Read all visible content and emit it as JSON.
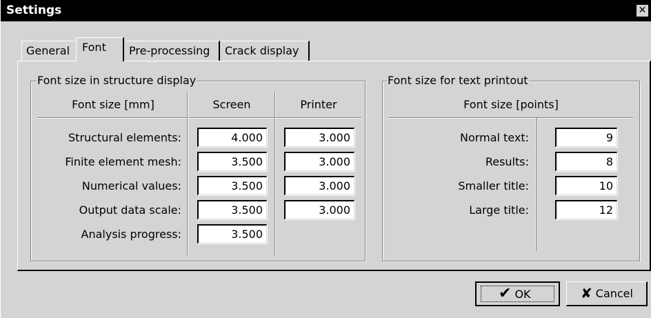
{
  "window": {
    "title": "Settings",
    "close_glyph": "✕"
  },
  "tabs": [
    {
      "label": "General"
    },
    {
      "label": "Font",
      "active": true
    },
    {
      "label": "Pre-processing"
    },
    {
      "label": "Crack display"
    }
  ],
  "structure_display": {
    "legend": "Font size in structure display",
    "col_header_label": "Font size [mm]",
    "col_header_screen": "Screen",
    "col_header_printer": "Printer",
    "rows": [
      {
        "label": "Structural elements:",
        "screen": "4.000",
        "printer": "3.000"
      },
      {
        "label": "Finite element mesh:",
        "screen": "3.500",
        "printer": "3.000"
      },
      {
        "label": "Numerical values:",
        "screen": "3.500",
        "printer": "3.000"
      },
      {
        "label": "Output data scale:",
        "screen": "3.500",
        "printer": "3.000"
      },
      {
        "label": "Analysis progress:",
        "screen": "3.500"
      }
    ]
  },
  "text_printout": {
    "legend": "Font size for text printout",
    "col_header": "Font size [points]",
    "rows": [
      {
        "label": "Normal text:",
        "value": "9"
      },
      {
        "label": "Results:",
        "value": "8"
      },
      {
        "label": "Smaller title:",
        "value": "10"
      },
      {
        "label": "Large title:",
        "value": "12"
      }
    ]
  },
  "buttons": {
    "ok_label": "OK",
    "ok_icon": "check-icon",
    "cancel_label": "Cancel",
    "cancel_icon": "x-icon"
  }
}
